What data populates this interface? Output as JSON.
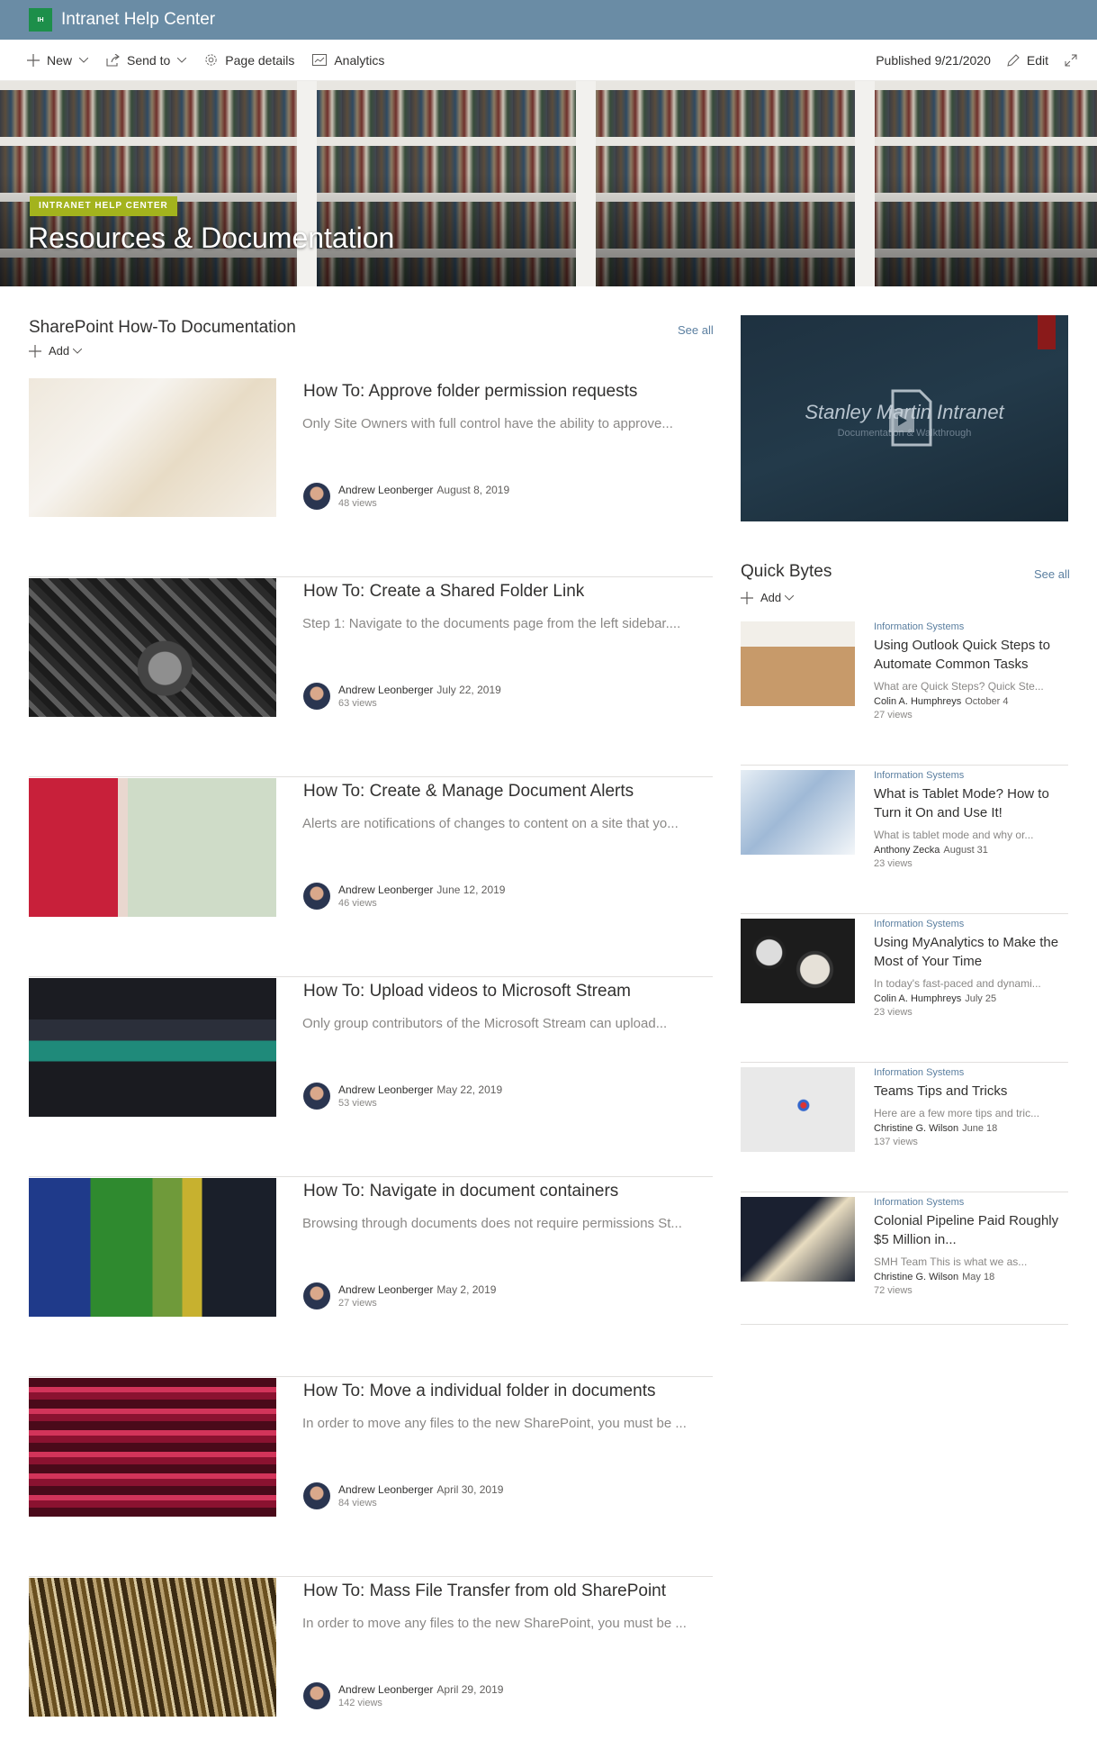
{
  "suite": {
    "logo_text": "IH",
    "site_name": "Intranet Help Center"
  },
  "command_bar": {
    "new_label": "New",
    "send_to_label": "Send to",
    "page_details_label": "Page details",
    "analytics_label": "Analytics",
    "published_label": "Published 9/21/2020",
    "edit_label": "Edit"
  },
  "hero": {
    "badge": "INTRANET HELP CENTER",
    "title": "Resources & Documentation"
  },
  "howto": {
    "title": "SharePoint How-To Documentation",
    "see_all": "See all",
    "add_label": "Add",
    "articles": [
      {
        "title": "How To: Approve folder permission requests",
        "desc": "Only Site Owners with full control have the ability to approve...",
        "author": "Andrew Leonberger",
        "date": "August 8, 2019",
        "views": "48 views"
      },
      {
        "title": "How To: Create a Shared Folder Link",
        "desc": "Step 1: Navigate to the documents page from the left sidebar....",
        "author": "Andrew Leonberger",
        "date": "July 22, 2019",
        "views": "63 views"
      },
      {
        "title": "How To: Create & Manage Document Alerts",
        "desc": "Alerts are notifications of changes to content on a site that yo...",
        "author": "Andrew Leonberger",
        "date": "June 12, 2019",
        "views": "46 views"
      },
      {
        "title": "How To: Upload videos to Microsoft Stream",
        "desc": "Only group contributors of the Microsoft Stream can upload...",
        "author": "Andrew Leonberger",
        "date": "May 22, 2019",
        "views": "53 views"
      },
      {
        "title": "How To: Navigate in document containers",
        "desc": "Browsing through documents does not require permissions St...",
        "author": "Andrew Leonberger",
        "date": "May 2, 2019",
        "views": "27 views"
      },
      {
        "title": "How To: Move a individual folder in documents",
        "desc": "In order to move any files to the new SharePoint, you must be ...",
        "author": "Andrew Leonberger",
        "date": "April 30, 2019",
        "views": "84 views"
      },
      {
        "title": "How To: Mass File Transfer from old SharePoint",
        "desc": "In order to move any files to the new SharePoint, you must be ...",
        "author": "Andrew Leonberger",
        "date": "April 29, 2019",
        "views": "142 views"
      }
    ]
  },
  "video": {
    "title": "Stanley Martin Intranet",
    "subtitle": "Documentation & Walkthrough"
  },
  "quick_bytes": {
    "title": "Quick Bytes",
    "see_all": "See all",
    "add_label": "Add",
    "items": [
      {
        "category": "Information Systems",
        "title": "Using Outlook Quick Steps to Automate Common Tasks",
        "desc": "What are Quick Steps? Quick Ste...",
        "author": "Colin A. Humphreys",
        "date": "October 4",
        "views": "27 views"
      },
      {
        "category": "Information Systems",
        "title": "What is Tablet Mode? How to Turn it On and Use It!",
        "desc": "What is tablet mode and why or...",
        "author": "Anthony Zecka",
        "date": "August 31",
        "views": "23 views"
      },
      {
        "category": "Information Systems",
        "title": "Using MyAnalytics to Make the Most of Your Time",
        "desc": "In today's fast-paced and dynami...",
        "author": "Colin A. Humphreys",
        "date": "July 25",
        "views": "23 views"
      },
      {
        "category": "Information Systems",
        "title": "Teams Tips and Tricks",
        "desc": "Here are a few more tips and tric...",
        "author": "Christine G. Wilson",
        "date": "June 18",
        "views": "137 views"
      },
      {
        "category": "Information Systems",
        "title": "Colonial Pipeline Paid Roughly $5 Million in...",
        "desc": "SMH Team This is what we as...",
        "author": "Christine G. Wilson",
        "date": "May 18",
        "views": "72 views"
      }
    ]
  }
}
